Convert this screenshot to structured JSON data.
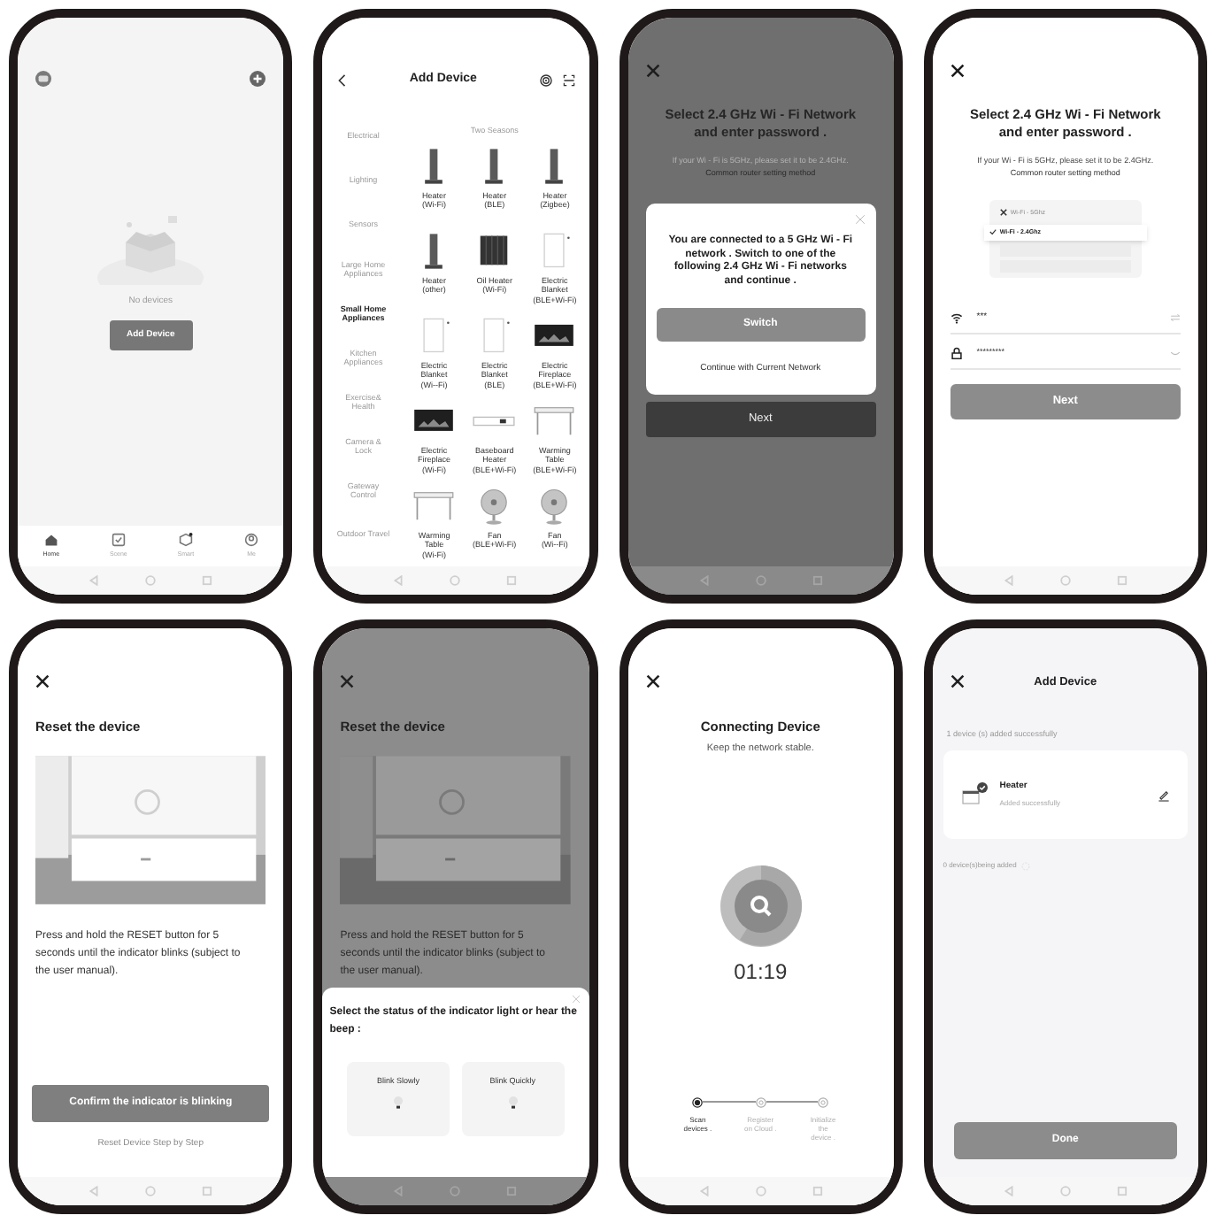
{
  "screens": [
    {
      "kind": "home",
      "empty_text": "No devices",
      "button": "Add Device",
      "tabs": [
        {
          "label": "Home",
          "selected": true
        },
        {
          "label": "Scene",
          "selected": false
        },
        {
          "label": "Smart",
          "selected": false
        },
        {
          "label": "Me",
          "selected": false
        }
      ]
    },
    {
      "kind": "catalog",
      "title": "Add Device",
      "section": "Two Seasons",
      "categories": [
        {
          "label": "Electrical",
          "selected": false
        },
        {
          "label": "Lighting",
          "selected": false
        },
        {
          "label": "Sensors",
          "selected": false
        },
        {
          "label": "Large Home\nAppliances",
          "selected": false
        },
        {
          "label": "Small Home\nAppliances",
          "selected": true
        },
        {
          "label": "Kitchen\nAppliances",
          "selected": false
        },
        {
          "label": "Exercise&\nHealth",
          "selected": false
        },
        {
          "label": "Camera &\nLock",
          "selected": false
        },
        {
          "label": "Gateway\nControl",
          "selected": false
        },
        {
          "label": "Outdoor Travel",
          "selected": false
        }
      ],
      "devices": [
        {
          "label": "Heater\n(Wi-Fi)",
          "kind": "tower"
        },
        {
          "label": "Heater\n(BLE)",
          "kind": "tower"
        },
        {
          "label": "Heater\n(Zigbee)",
          "kind": "tower"
        },
        {
          "label": "Heater\n(other)",
          "kind": "tower"
        },
        {
          "label": "Oil Heater\n(Wi-Fi)",
          "kind": "radiator"
        },
        {
          "label": "Electric\nBlanket\n(BLE+Wi-Fi)",
          "kind": "blanket"
        },
        {
          "label": "Electric\nBlanket\n(Wi--Fi)",
          "kind": "blanket"
        },
        {
          "label": "Electric\nBlanket\n(BLE)",
          "kind": "blanket"
        },
        {
          "label": "Electric\nFireplace\n(BLE+Wi-Fi)",
          "kind": "fireplace"
        },
        {
          "label": "Electric\nFireplace\n(Wi-Fi)",
          "kind": "fireplace"
        },
        {
          "label": "Baseboard\nHeater\n(BLE+Wi-Fi)",
          "kind": "baseboard"
        },
        {
          "label": "Warming\nTable\n(BLE+Wi-Fi)",
          "kind": "table"
        },
        {
          "label": "Warming\nTable\n(Wi-Fi)",
          "kind": "table"
        },
        {
          "label": "Fan\n(BLE+Wi-Fi)",
          "kind": "fan"
        },
        {
          "label": "Fan\n(Wi--Fi)",
          "kind": "fan"
        }
      ]
    },
    {
      "kind": "wifi_dialog",
      "title": "Select  2.4 GHz Wi - Fi Network and enter password .",
      "hint": "If your Wi - Fi is 5GHz, please set it to be 2.4GHz.",
      "hint_link": "Common router setting method",
      "dialog": {
        "message": "You are connected to a 5 GHz Wi - Fi network . Switch to one of the following 2.4 GHz Wi - Fi networks and continue .",
        "primary": "Switch",
        "secondary": "Continue with Current Network"
      },
      "button": "Next"
    },
    {
      "kind": "wifi_form",
      "title": "Select  2.4 GHz Wi - Fi Network and enter password .",
      "hint": "If your Wi - Fi is 5GHz, please set it to be 2.4GHz.",
      "hint_link": "Common router setting method",
      "networks": [
        {
          "label": "Wi-Fi - 5Ghz",
          "selected": false
        },
        {
          "label": "Wi-Fi - 2.4Ghz",
          "selected": true
        }
      ],
      "network_name": "***",
      "password": "*********",
      "button": "Next"
    },
    {
      "kind": "reset",
      "title": "Reset the device",
      "instructions": "Press and hold the RESET button for 5 seconds until the indicator blinks (subject to the user manual).",
      "button": "Confirm the indicator is blinking",
      "link": "Reset Device Step by Step"
    },
    {
      "kind": "reset_sheet",
      "title": "Reset the device",
      "instructions": "Press and hold the RESET button for 5 seconds until the indicator blinks (subject to the user manual).",
      "sheet_title": "Select the status of the indicator light or hear the beep :",
      "options": [
        "Blink Slowly",
        "Blink Quickly"
      ]
    },
    {
      "kind": "connecting",
      "title": "Connecting Device",
      "subtitle": "Keep the network stable.",
      "timer": "01:19",
      "steps": [
        {
          "label": "Scan\ndevices .",
          "selected": true
        },
        {
          "label": "Register\non Cloud .",
          "selected": false
        },
        {
          "label": "Initialize\nthe\ndevice .",
          "selected": false
        }
      ]
    },
    {
      "kind": "result",
      "title": "Add Device",
      "added_label": "1 device (s) added successfully",
      "device": {
        "name": "Heater",
        "status": "Added successfully"
      },
      "pending_label": "0 device(s)being added",
      "button": "Done"
    }
  ]
}
